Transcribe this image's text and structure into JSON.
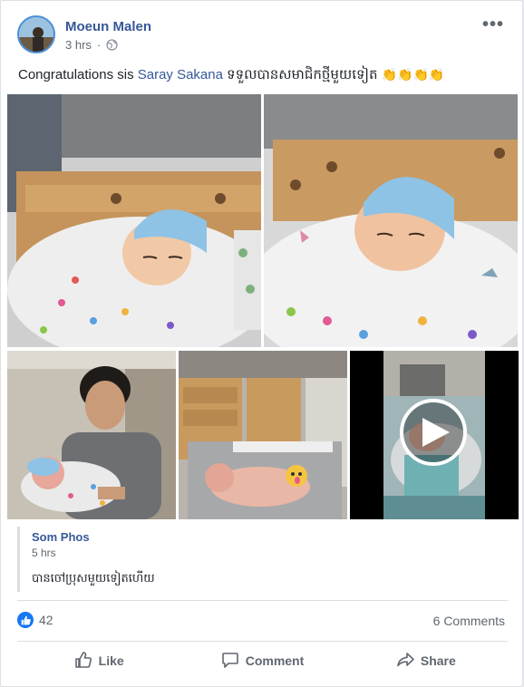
{
  "post": {
    "author": "Moeun Malen",
    "time": "3 hrs",
    "text_prefix": "Congratulations sis ",
    "mention": "Saray Sakana",
    "text_suffix": " ទទួលបានសមាជិកថ្មីមួយទៀត ",
    "text_emoji": "👏👏👏👏",
    "icons": {
      "more": "more-options-icon",
      "privacy": "globe-icon",
      "play": "play-icon",
      "like": "like-icon",
      "comment": "comment-icon",
      "share": "share-icon"
    }
  },
  "shared_comment": {
    "author": "Som Phos",
    "time": "5 hrs",
    "text": "បានចៅប្រុសមួយទៀតហើយ"
  },
  "stats": {
    "likes": "42",
    "comments": "6 Comments"
  },
  "actions": {
    "like": "Like",
    "comment": "Comment",
    "share": "Share"
  },
  "colors": {
    "link": "#365899",
    "like_blue": "#1877f2",
    "muted": "#606770"
  }
}
